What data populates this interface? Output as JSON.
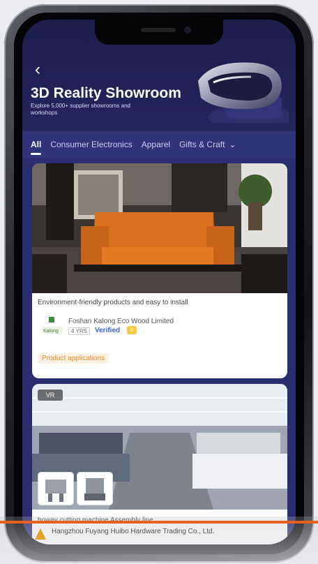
{
  "status_bar": {
    "time": "",
    "icons": ""
  },
  "header": {
    "title": "3D Reality Showroom",
    "subtitle": "Explore 5,000+ supplier showrooms and workshops"
  },
  "tabs": [
    {
      "label": "All",
      "active": true
    },
    {
      "label": "Consumer Electronics",
      "active": false
    },
    {
      "label": "Apparel",
      "active": false
    },
    {
      "label": "Gifts & Craft",
      "active": false
    }
  ],
  "cards": [
    {
      "description": "Environment-friendly products and easy to install",
      "company": "Foshan Kalong Eco Wood Limited",
      "years": "4 YRS",
      "verified": "Verified",
      "tag": "Product applications"
    },
    {
      "vr_badge": "VR",
      "description": "boway cutting machine Assembly line",
      "company": "Hangzhou Fuyang Huibo Hardware Trading Co., Ltd."
    }
  ],
  "colors": {
    "header_bg": "#1b1d4b",
    "tabs_bg": "#2f3478",
    "feed_bg": "#2a2d6e",
    "verified": "#3a63d6",
    "tag": "#e08a2e",
    "accent_line": "#e8611d"
  }
}
